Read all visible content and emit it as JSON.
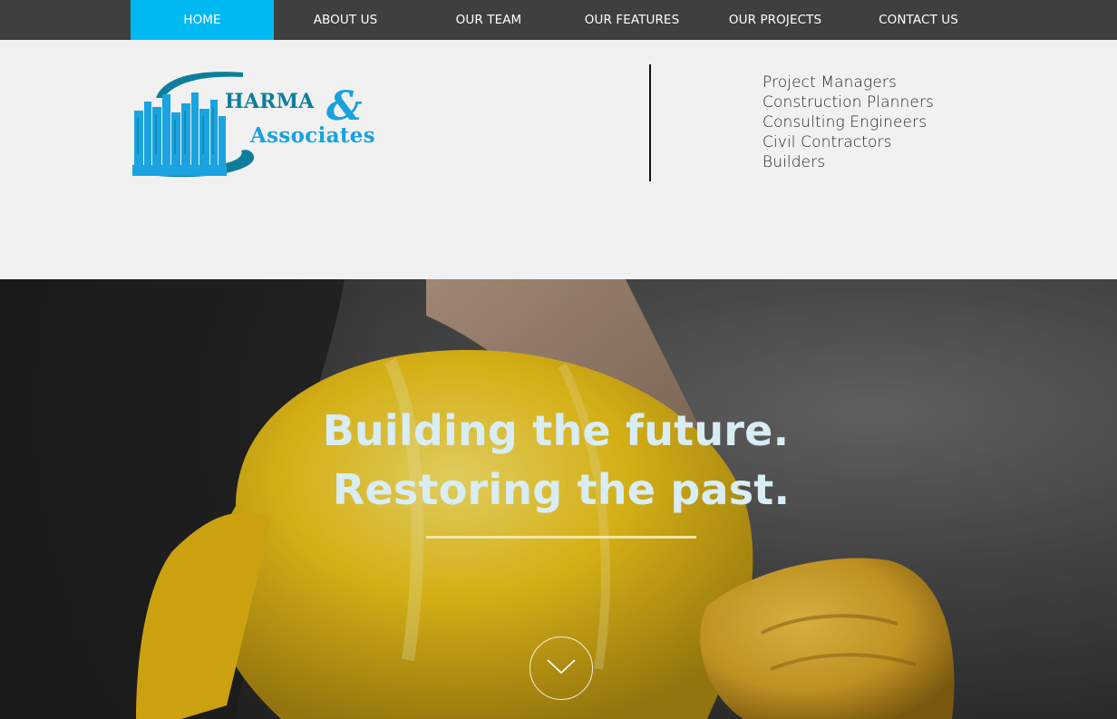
{
  "nav": {
    "items": [
      {
        "label": "HOME",
        "active": true
      },
      {
        "label": "ABOUT US",
        "active": false
      },
      {
        "label": "OUR TEAM",
        "active": false
      },
      {
        "label": "OUR FEATURES",
        "active": false
      },
      {
        "label": "OUR PROJECTS",
        "active": false
      },
      {
        "label": "CONTACT US",
        "active": false
      }
    ]
  },
  "header": {
    "logo": {
      "line1": "HARMA",
      "ampersand": "&",
      "line2": "Associates"
    },
    "services": [
      "Project Managers",
      "Construction Planners",
      "Consulting Engineers",
      "Civil Contractors",
      "Builders"
    ]
  },
  "hero": {
    "title_line1": "Building the future.",
    "title_line2": "Restoring the past."
  },
  "colors": {
    "nav_bg": "#3f3f3f",
    "nav_active": "#00b9f2",
    "header_bg": "#f1f1f1",
    "hero_text": "#d8edf5",
    "hero_rule": "#f7e7a3",
    "helmet": "#f2c81a",
    "logo_teal": "#0e7e9b",
    "logo_blue": "#19a1de"
  },
  "icons": {
    "scroll": "chevron-down-icon",
    "logo_mark": "city-skyline-icon"
  }
}
